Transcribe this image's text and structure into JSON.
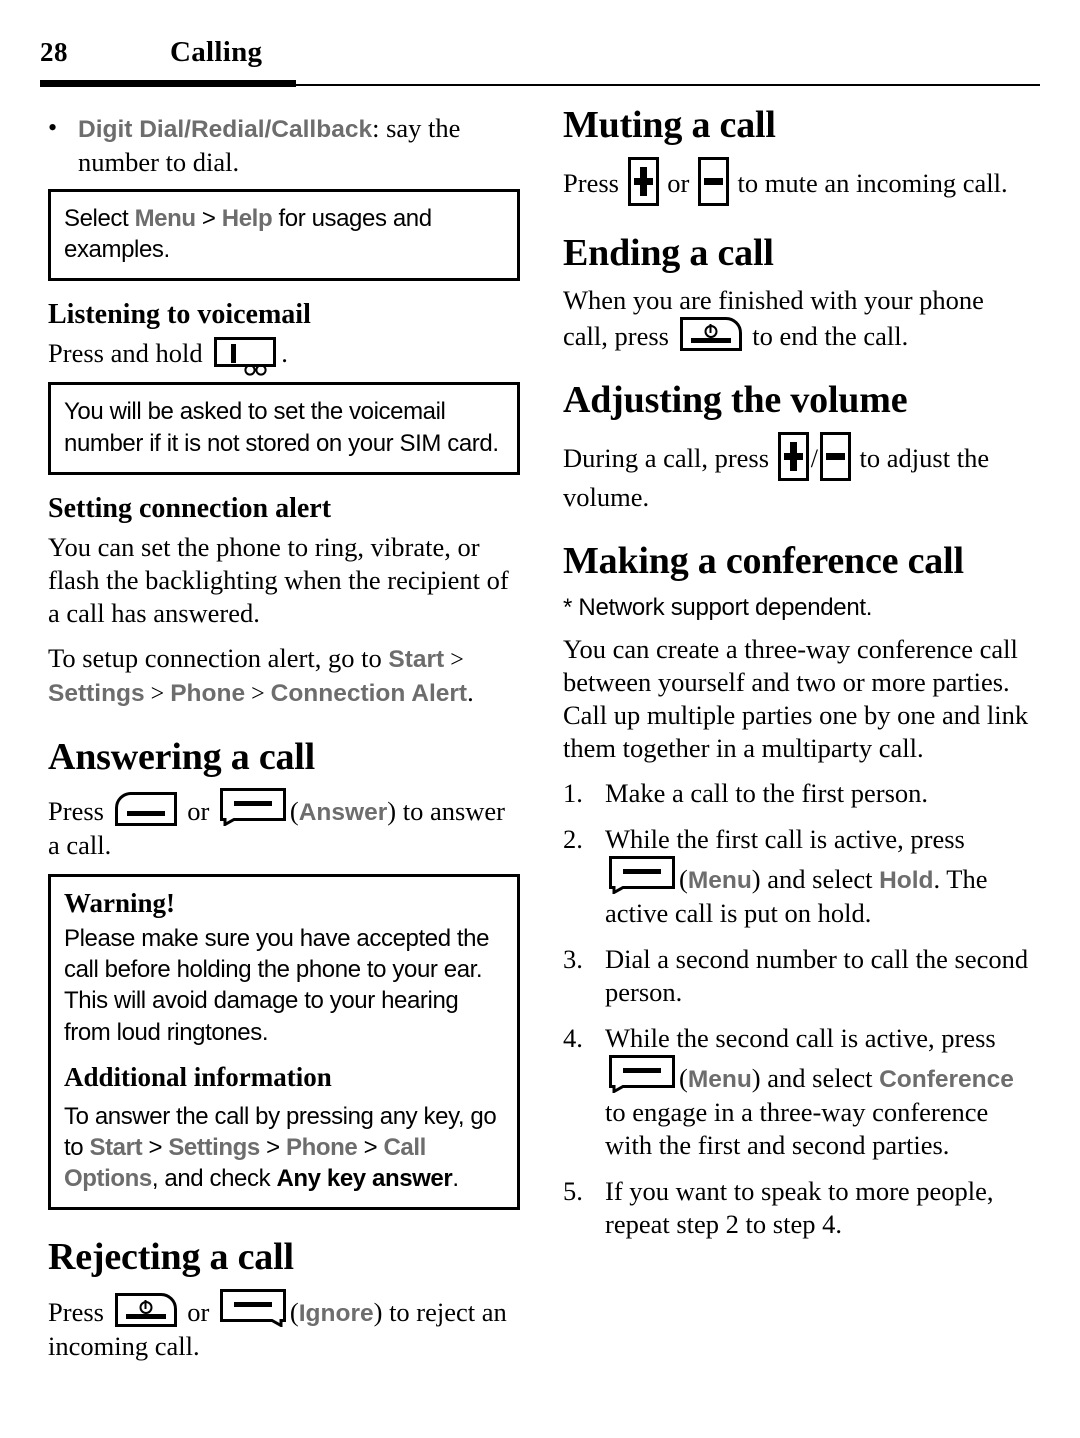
{
  "header": {
    "page_number": "28",
    "chapter": "Calling"
  },
  "icons": {
    "send_key": "send-key-icon",
    "end_key": "end-key-icon",
    "left_softkey": "left-softkey-icon",
    "right_softkey": "right-softkey-icon",
    "volume_up_key": "volume-up-key-icon",
    "volume_down_key": "volume-down-key-icon",
    "key_one_voicemail": "key-one-voicemail-icon"
  },
  "colors": {
    "ui_term_gray": "#6d6d6d",
    "text_black": "#000000",
    "page_background": "#ffffff"
  },
  "left_column": {
    "bullet": {
      "marker": "•",
      "term": "Digit Dial/Redial/Callback",
      "rest": ": say the number to dial."
    },
    "note_help": {
      "part1": "Select ",
      "menu": "Menu",
      "gt": " > ",
      "help": "Help",
      "part2": " for usages and examples."
    },
    "voicemail": {
      "title": "Listening to voicemail",
      "press_label": "Press and hold",
      "trailing": "."
    },
    "note_voicemail": {
      "text": "You will be asked to set the voicemail number if it is not stored on your SIM card."
    },
    "connection_alert": {
      "title": "Setting connection alert",
      "para1": "You can set the phone to ring, vibrate, or flash the backlighting when the recipient of a call has answered.",
      "para2_lead": "To setup connection alert, go to ",
      "start": "Start",
      "gt1": " > ",
      "settings": "Settings",
      "gt2": " > ",
      "phone": "Phone",
      "gt3": " > ",
      "connection_alert": "Connection Alert",
      "period": "."
    },
    "answering": {
      "title": "Answering a call",
      "press": "Press",
      "or": "or",
      "answer_paren_open": "(",
      "answer_label": "Answer",
      "answer_paren_close": ")",
      "tail": " to answer a call."
    },
    "warning": {
      "title": "Warning!",
      "body": "Please make sure you have accepted the call before holding the phone to your ear. This will avoid damage to your hearing from loud ringtones.",
      "additional_title": "Additional information",
      "additional_lead": "To answer the call by pressing any key, go to ",
      "start": "Start",
      "gt1": " > ",
      "settings": "Settings",
      "gt2": " > ",
      "phone": "Phone",
      "gt3": " > ",
      "call_options": "Call Options",
      "mid": ", and check ",
      "any_key_answer": "Any key answer",
      "period": "."
    },
    "rejecting": {
      "title": "Rejecting a call",
      "press": "Press",
      "or": "or",
      "ignore_paren_open": "(",
      "ignore_label": "Ignore",
      "ignore_paren_close": ")",
      "tail": " to reject an incoming call."
    }
  },
  "right_column": {
    "muting": {
      "title": "Muting a call",
      "press": "Press",
      "or": "or",
      "tail": " to mute an incoming call."
    },
    "ending": {
      "title": "Ending a call",
      "lead": "When you are finished with your phone call, press ",
      "tail": " to end the call."
    },
    "adjusting": {
      "title": "Adjusting the volume",
      "lead": "During a call, press ",
      "slash": "/",
      "tail": " to adjust the volume."
    },
    "conference": {
      "title": "Making a conference call",
      "footnote": "*  Network support dependent.",
      "intro": "You can create a three-way conference call between yourself and two or more parties. Call up multiple parties one by one and link them together in a multiparty call.",
      "steps": [
        {
          "num": "1.",
          "text": "Make a call to the first person."
        },
        {
          "num": "2.",
          "lead": "While the first call is active, press ",
          "paren_open": "(",
          "softkey_label": "Menu",
          "paren_close": ")",
          "mid": " and select ",
          "selection": "Hold",
          "tail": ". The active call is put on hold."
        },
        {
          "num": "3.",
          "text": "Dial a second number to call the second person."
        },
        {
          "num": "4.",
          "lead": "While the second call is active, press ",
          "paren_open": "(",
          "softkey_label": "Menu",
          "paren_close": ")",
          "mid": " and select ",
          "selection": "Conference",
          "tail": " to engage in a three-way conference with the first and second parties."
        },
        {
          "num": "5.",
          "text": "If you want to speak to more people, repeat step 2 to step 4."
        }
      ]
    }
  }
}
